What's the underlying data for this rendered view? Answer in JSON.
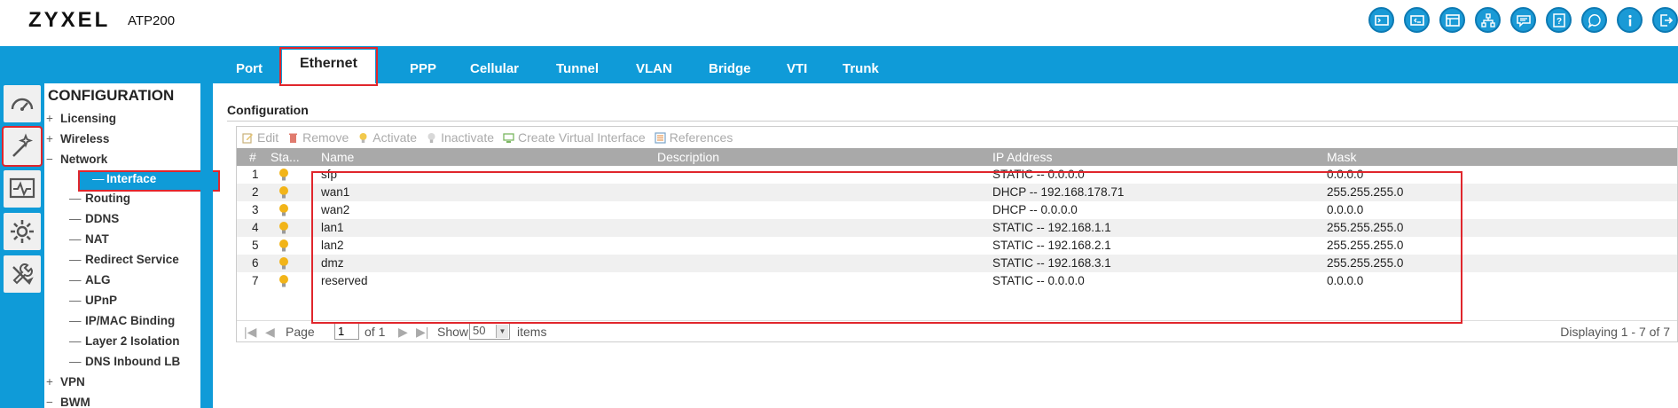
{
  "header": {
    "brand": "ZYXEL",
    "model": "ATP200"
  },
  "top_icons": [
    "console-icon",
    "cli-icon",
    "dashboard-window-icon",
    "network-map-icon",
    "chat-icon",
    "help-book-icon",
    "support-icon",
    "info-icon",
    "logout-icon"
  ],
  "tabs": [
    {
      "label": "Port"
    },
    {
      "label": "Ethernet"
    },
    {
      "label": "PPP"
    },
    {
      "label": "Cellular"
    },
    {
      "label": "Tunnel"
    },
    {
      "label": "VLAN"
    },
    {
      "label": "Bridge"
    },
    {
      "label": "VTI"
    },
    {
      "label": "Trunk"
    }
  ],
  "nav": {
    "title": "CONFIGURATION",
    "items": [
      {
        "prefix": "+",
        "label": "Licensing"
      },
      {
        "prefix": "+",
        "label": "Wireless"
      },
      {
        "prefix": "−",
        "label": "Network"
      },
      {
        "prefix": "—",
        "label": "Interface"
      },
      {
        "prefix": "—",
        "label": "Routing"
      },
      {
        "prefix": "—",
        "label": "DDNS"
      },
      {
        "prefix": "—",
        "label": "NAT"
      },
      {
        "prefix": "—",
        "label": "Redirect Service"
      },
      {
        "prefix": "—",
        "label": "ALG"
      },
      {
        "prefix": "—",
        "label": "UPnP"
      },
      {
        "prefix": "—",
        "label": "IP/MAC Binding"
      },
      {
        "prefix": "—",
        "label": "Layer 2 Isolation"
      },
      {
        "prefix": "—",
        "label": "DNS Inbound LB"
      },
      {
        "prefix": "+",
        "label": "VPN"
      },
      {
        "prefix": "−",
        "label": "BWM"
      }
    ]
  },
  "section_title": "Configuration",
  "toolbar": {
    "edit": "Edit",
    "remove": "Remove",
    "activate": "Activate",
    "inactivate": "Inactivate",
    "create_virtual": "Create Virtual Interface",
    "references": "References"
  },
  "table": {
    "headers": {
      "num": "#",
      "status": "Sta...",
      "name": "Name",
      "description": "Description",
      "ip": "IP Address",
      "mask": "Mask"
    },
    "rows": [
      {
        "num": "1",
        "name": "sfp",
        "description": "",
        "ip": "STATIC -- 0.0.0.0",
        "mask": "0.0.0.0"
      },
      {
        "num": "2",
        "name": "wan1",
        "description": "",
        "ip": "DHCP -- 192.168.178.71",
        "mask": "255.255.255.0"
      },
      {
        "num": "3",
        "name": "wan2",
        "description": "",
        "ip": "DHCP -- 0.0.0.0",
        "mask": "0.0.0.0"
      },
      {
        "num": "4",
        "name": "lan1",
        "description": "",
        "ip": "STATIC -- 192.168.1.1",
        "mask": "255.255.255.0"
      },
      {
        "num": "5",
        "name": "lan2",
        "description": "",
        "ip": "STATIC -- 192.168.2.1",
        "mask": "255.255.255.0"
      },
      {
        "num": "6",
        "name": "dmz",
        "description": "",
        "ip": "STATIC -- 192.168.3.1",
        "mask": "255.255.255.0"
      },
      {
        "num": "7",
        "name": "reserved",
        "description": "",
        "ip": "STATIC -- 0.0.0.0",
        "mask": "0.0.0.0"
      }
    ]
  },
  "pager": {
    "page_label": "Page",
    "page_value": "1",
    "of_label": "of 1",
    "show_label": "Show",
    "show_value": "50",
    "items_label": "items",
    "displaying": "Displaying 1 - 7 of 7"
  },
  "colors": {
    "accent": "#0f9bd8",
    "highlight": "#e0262c",
    "bulb": "#f2b418"
  }
}
